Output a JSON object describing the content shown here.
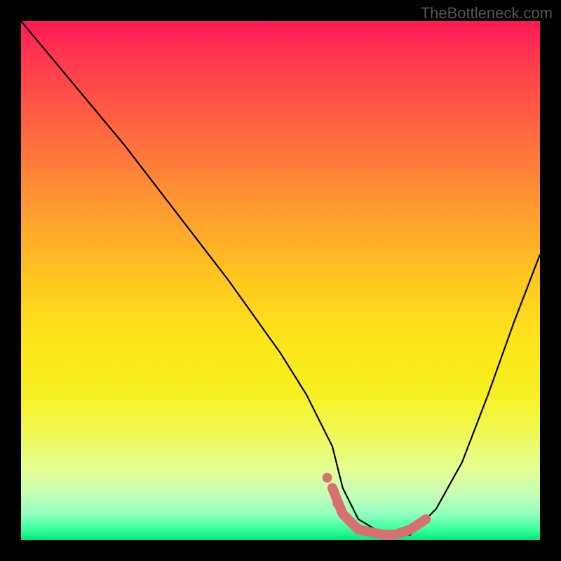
{
  "watermark": "TheBottleneck.com",
  "chart_data": {
    "type": "line",
    "title": "",
    "xlabel": "",
    "ylabel": "",
    "xlim": [
      0,
      100
    ],
    "ylim": [
      0,
      100
    ],
    "series": [
      {
        "name": "curve",
        "x": [
          0,
          5,
          10,
          20,
          30,
          40,
          50,
          55,
          60,
          62,
          65,
          70,
          72,
          75,
          80,
          85,
          90,
          95,
          100
        ],
        "y": [
          100,
          94,
          88,
          76,
          63,
          50,
          36,
          28,
          18,
          10,
          4,
          1,
          1,
          1,
          6,
          15,
          28,
          42,
          55
        ]
      }
    ],
    "highlight_segment": {
      "x": [
        60,
        62,
        65,
        70,
        72,
        75,
        78
      ],
      "y": [
        10,
        5,
        2,
        1,
        1,
        2,
        4
      ],
      "color": "#d87070"
    },
    "highlight_points": [
      {
        "x": 59,
        "y": 12
      },
      {
        "x": 61,
        "y": 7
      }
    ]
  }
}
